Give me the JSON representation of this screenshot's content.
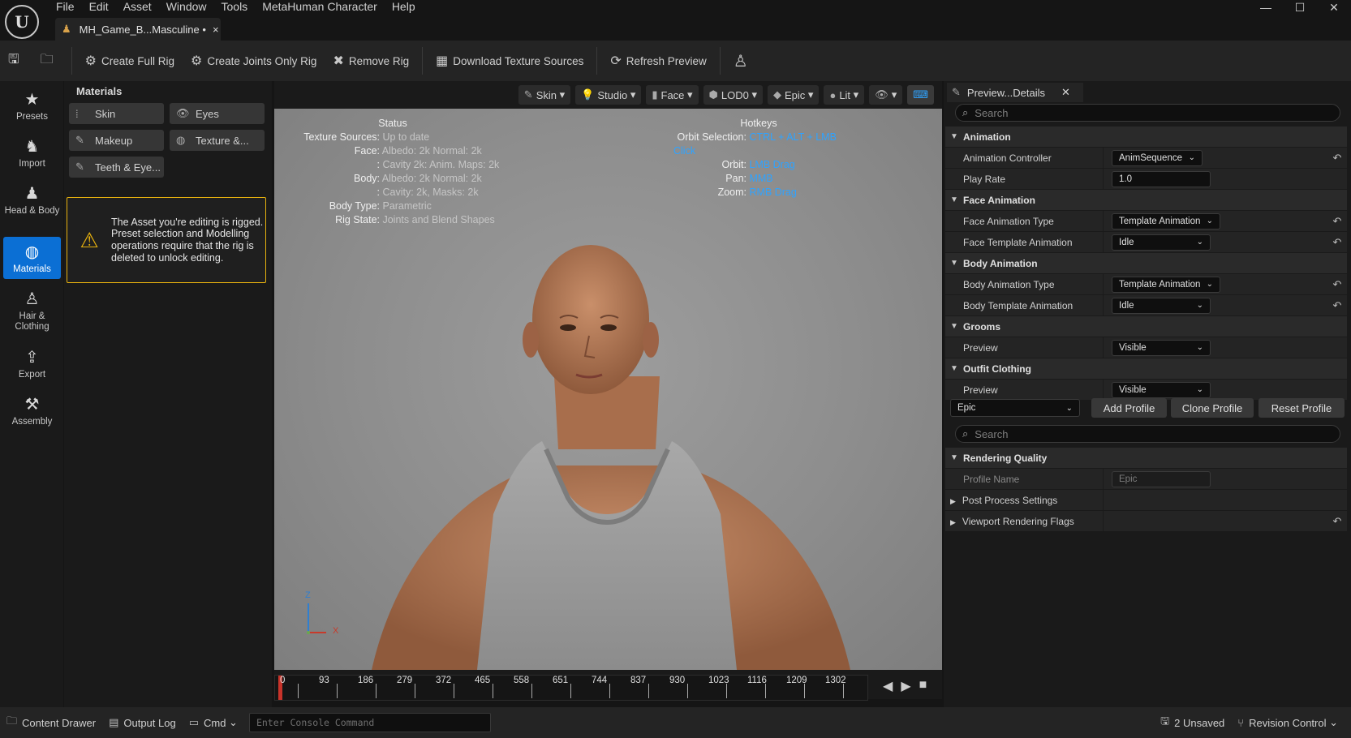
{
  "menu": [
    "File",
    "Edit",
    "Asset",
    "Window",
    "Tools",
    "MetaHuman Character",
    "Help"
  ],
  "window_controls": {
    "minimize": "—",
    "maximize": "☐",
    "close": "✕"
  },
  "doc_tab": {
    "title": "MH_Game_B...Masculine •",
    "close": "×"
  },
  "toolbar": {
    "create_full_rig": "Create Full Rig",
    "create_joints_rig": "Create Joints Only Rig",
    "remove_rig": "Remove Rig",
    "download_textures": "Download Texture Sources",
    "refresh_preview": "Refresh Preview"
  },
  "left_rail": [
    {
      "label": "Presets",
      "icon": "star-icon"
    },
    {
      "label": "Import",
      "icon": "import-icon"
    },
    {
      "label": "Head & Body",
      "icon": "body-icon"
    },
    {
      "label": "Materials",
      "icon": "materials-icon",
      "active": true
    },
    {
      "label": "Hair & Clothing",
      "icon": "hair-icon"
    },
    {
      "label": "Export",
      "icon": "export-icon"
    },
    {
      "label": "Assembly",
      "icon": "hammer-icon"
    }
  ],
  "materials": {
    "title": "Materials",
    "buttons": [
      "Skin",
      "Eyes",
      "Makeup",
      "Texture &...",
      "Teeth & Eye..."
    ],
    "warning": "The Asset you're editing is rigged. Preset selection and Modelling operations require that the rig is deleted to unlock editing."
  },
  "viewport": {
    "toolbar": [
      "Skin",
      "Studio",
      "Face",
      "LOD0",
      "Epic",
      "Lit"
    ],
    "status_title": "Status",
    "status": [
      {
        "k": "Texture Sources:",
        "v": "Up to date"
      },
      {
        "k": "Face:",
        "v": "Albedo: 2k Normal: 2k"
      },
      {
        "k": ":",
        "v": "Cavity 2k: Anim. Maps: 2k"
      },
      {
        "k": "Body:",
        "v": "Albedo: 2k Normal: 2k"
      },
      {
        "k": ":",
        "v": "Cavity: 2k, Masks: 2k"
      },
      {
        "k": "Body Type:",
        "v": "Parametric"
      },
      {
        "k": "Rig State:",
        "v": "Joints and Blend Shapes"
      }
    ],
    "hotkeys_title": "Hotkeys",
    "hotkeys": [
      {
        "k": "Orbit Selection:",
        "v": "CTRL + ALT + LMB Click"
      },
      {
        "k": "Orbit:",
        "v": "LMB Drag"
      },
      {
        "k": "Pan:",
        "v": "MMB"
      },
      {
        "k": "Zoom:",
        "v": "RMB Drag"
      }
    ],
    "axis": {
      "z": "Z",
      "x": "X"
    },
    "timeline": [
      "0",
      "93",
      "186",
      "279",
      "372",
      "465",
      "558",
      "651",
      "744",
      "837",
      "930",
      "1023",
      "1116",
      "1209",
      "1302"
    ]
  },
  "details": {
    "tab": "Preview...Details",
    "search_placeholder": "Search",
    "animation": "Animation",
    "anim_controller_label": "Animation Controller",
    "anim_controller_value": "AnimSequence",
    "play_rate_label": "Play Rate",
    "play_rate_value": "1.0",
    "face_animation": "Face Animation",
    "face_anim_type_label": "Face Animation Type",
    "face_anim_type_value": "Template Animation",
    "face_template_label": "Face Template Animation",
    "face_template_value": "Idle",
    "body_animation": "Body Animation",
    "body_anim_type_label": "Body Animation Type",
    "body_anim_type_value": "Template Animation",
    "body_template_label": "Body Template Animation",
    "body_template_value": "Idle",
    "grooms": "Grooms",
    "grooms_preview_label": "Preview",
    "grooms_preview_value": "Visible",
    "outfit": "Outfit Clothing",
    "outfit_preview_label": "Preview",
    "outfit_preview_value": "Visible",
    "profile_value": "Epic",
    "add_profile": "Add Profile",
    "clone_profile": "Clone Profile",
    "reset_profile": "Reset Profile",
    "search2_placeholder": "Search",
    "rendering_quality": "Rendering Quality",
    "profile_name_label": "Profile Name",
    "profile_name_value": "Epic",
    "post_process": "Post Process Settings",
    "viewport_flags": "Viewport Rendering Flags"
  },
  "statusbar": {
    "content_drawer": "Content Drawer",
    "output_log": "Output Log",
    "cmd": "Cmd",
    "console_placeholder": "Enter Console Command",
    "unsaved": "2 Unsaved",
    "revision_control": "Revision Control"
  },
  "colors": {
    "accent": "#0b6fd4",
    "warning": "#e8b20e",
    "link": "#2fa3ff"
  }
}
